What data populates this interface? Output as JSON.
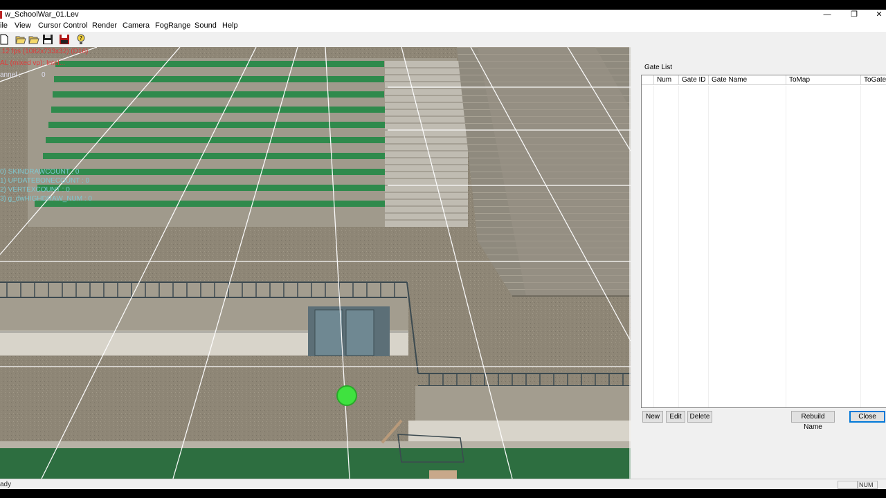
{
  "window": {
    "title": "w_SchoolWar_01.Lev",
    "minimize": "—",
    "restore": "❐",
    "close": "✕"
  },
  "menu": {
    "items": [
      "ile",
      "View",
      "Cursor Control",
      "Render",
      "Camera",
      "FogRange",
      "Sound",
      "Help"
    ]
  },
  "toolbar": {
    "icons": [
      "new-file-icon",
      "open-folder-icon",
      "open-folder-icon",
      "save-disk-icon",
      "save-as-disk-icon",
      "help-icon"
    ]
  },
  "viewport": {
    "overlay": {
      "fps": ".12 fps (1082x733x32) (D16)",
      "device": "AL (mixed vp): Intel...",
      "channel": "annel :",
      "channel_value": "0",
      "stats": [
        "0) SKINDRAWCOUNT : 0",
        "1) UPDATEBONECOUNT : 0",
        "2) VERTEXCOUNT : 0",
        "3) g_dwHIGHDRAW_NUM : 0"
      ]
    },
    "colors": {
      "floor": "#8e8676",
      "seats": "#2f8a4c",
      "grid": "#ffffff",
      "marker": "#3fe23f"
    }
  },
  "gate_panel": {
    "title": "Gate List",
    "columns": [
      "",
      "Num",
      "Gate ID",
      "Gate Name",
      "ToMap",
      "ToGate"
    ],
    "rows": [],
    "buttons": {
      "new": "New",
      "edit": "Edit",
      "delete": "Delete",
      "rebuild": "Rebuild Name",
      "close": "Close"
    }
  },
  "status": {
    "text": "ady",
    "num": "NUM"
  }
}
